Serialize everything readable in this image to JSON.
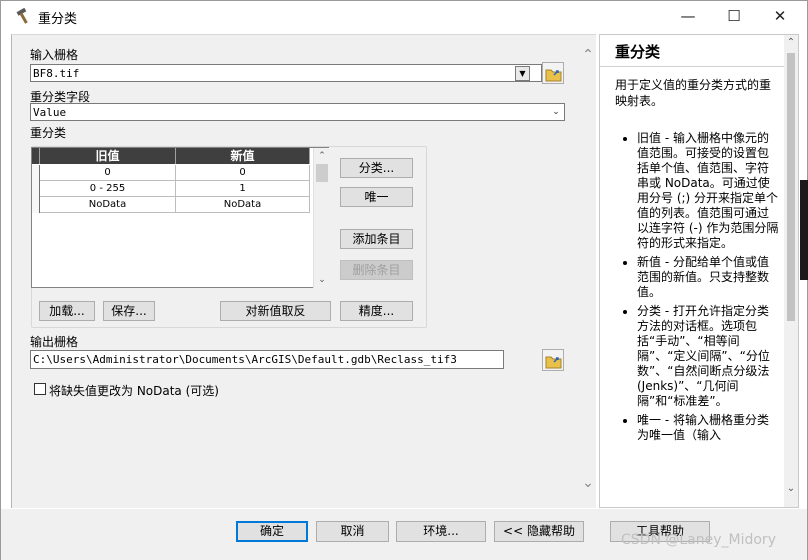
{
  "window": {
    "title": "重分类"
  },
  "form": {
    "input_raster_label": "输入栅格",
    "input_raster_value": "BF8.tif",
    "reclass_field_label": "重分类字段",
    "reclass_field_value": "Value",
    "reclass_label": "重分类",
    "table_headers": [
      "旧值",
      "新值"
    ],
    "table_rows": [
      {
        "old": "0",
        "new": "0"
      },
      {
        "old": "0 - 255",
        "new": "1"
      },
      {
        "old": "NoData",
        "new": "NoData"
      }
    ],
    "buttons": {
      "classify": "分类...",
      "unique": "唯一",
      "add_entry": "添加条目",
      "delete_entry": "删除条目",
      "load": "加载...",
      "save": "保存...",
      "reverse": "对新值取反",
      "precision": "精度..."
    },
    "output_raster_label": "输出栅格",
    "output_raster_value": "C:\\Users\\Administrator\\Documents\\ArcGIS\\Default.gdb\\Reclass_tif3",
    "nodata_checkbox_label": "将缺失值更改为 NoData (可选)"
  },
  "help": {
    "title": "重分类",
    "intro": "用于定义值的重分类方式的重映射表。",
    "items": [
      "旧值 - 输入栅格中像元的值范围。可接受的设置包括单个值、值范围、字符串或 NoData。可通过使用分号 (;) 分开来指定单个值的列表。值范围可通过以连字符 (-) 作为范围分隔符的形式来指定。",
      "新值 - 分配给单个值或值范围的新值。只支持整数值。",
      "分类 - 打开允许指定分类方法的对话框。选项包括“手动”、“相等间隔”、“定义间隔”、“分位数”、“自然间断点分级法 (Jenks)”、“几何间隔”和“标准差”。",
      "唯一 - 将输入栅格重分类为唯一值（输入"
    ]
  },
  "bottom_buttons": {
    "ok": "确定",
    "cancel": "取消",
    "environment": "环境...",
    "hide_help": "<< 隐藏帮助",
    "tool_help": "工具帮助"
  },
  "watermark": "CSDN @Laney_Midory"
}
